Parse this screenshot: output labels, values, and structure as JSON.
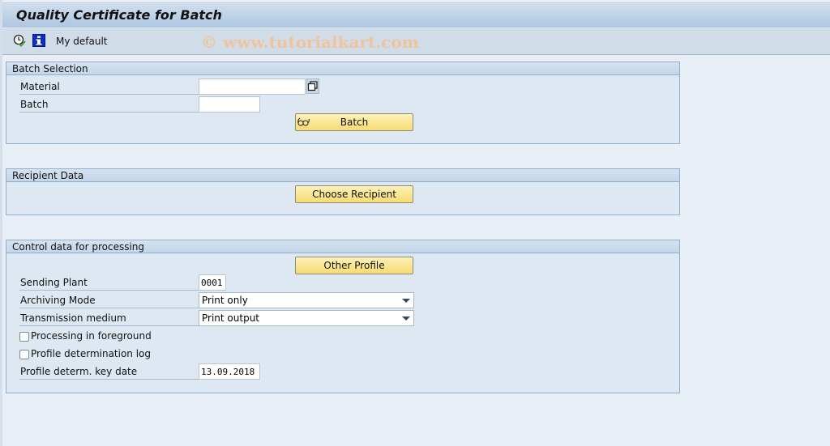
{
  "window": {
    "title": "Quality Certificate for Batch"
  },
  "toolbar": {
    "items": [
      {
        "icon": "execute-clock-icon",
        "label": ""
      },
      {
        "icon": "info-icon",
        "label": ""
      }
    ],
    "variant_label": "My default",
    "watermark": "© www.tutorialkart.com"
  },
  "batch_selection": {
    "title": "Batch Selection",
    "material_label": "Material",
    "material_value": "",
    "batch_label": "Batch",
    "batch_value": "",
    "batch_button": "Batch",
    "batch_button_icon": "glasses-icon",
    "material_help_icon": "multiple-selection-icon"
  },
  "recipient_data": {
    "title": "Recipient Data",
    "choose_recipient_button": "Choose Recipient"
  },
  "control_data": {
    "title": "Control data for processing",
    "other_profile_button": "Other Profile",
    "sending_plant_label": "Sending Plant",
    "sending_plant_value": "0001",
    "archiving_mode_label": "Archiving Mode",
    "archiving_mode_value": "Print only",
    "transmission_medium_label": "Transmission medium",
    "transmission_medium_value": "Print output",
    "processing_foreground_label": "Processing in foreground",
    "processing_foreground_checked": false,
    "profile_log_label": "Profile determination log",
    "profile_log_checked": false,
    "key_date_label": "Profile determ. key date",
    "key_date_value": "13.09.2018"
  }
}
